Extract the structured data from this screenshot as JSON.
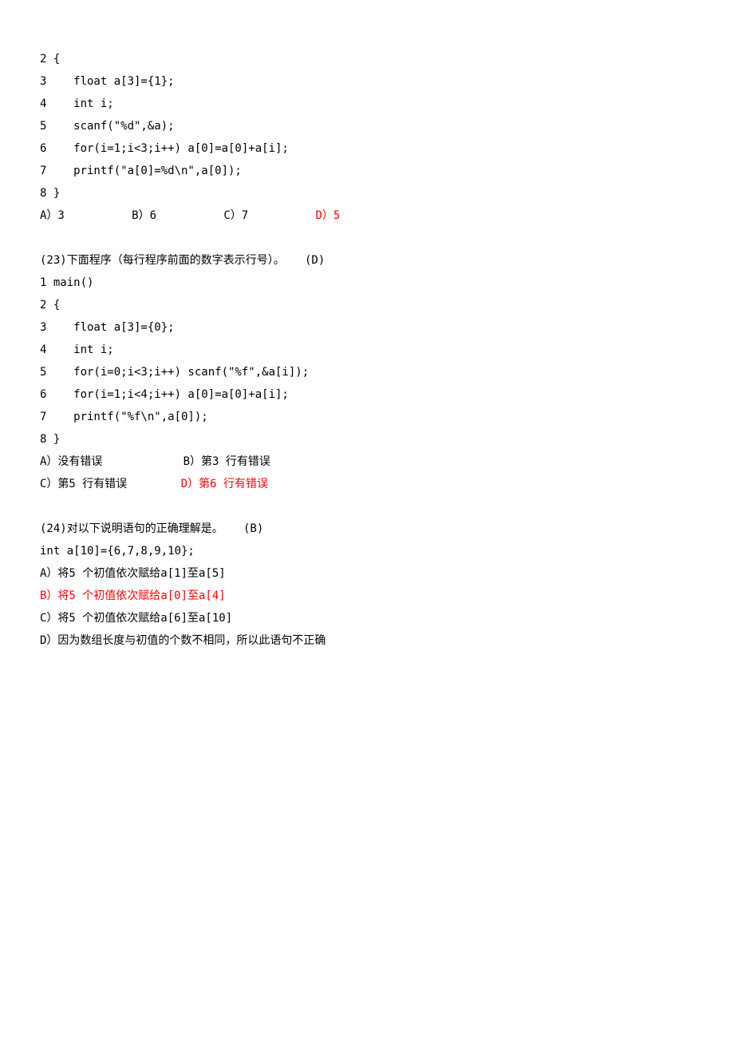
{
  "q22": {
    "code": [
      "2 {",
      "3    float a[3]={1};",
      "4    int i;",
      "5    scanf(\"%d\",&a);",
      "6    for(i=1;i<3;i++) a[0]=a[0]+a[i];",
      "7    printf(\"a[0]=%d\\n\",a[0]);",
      "8 }"
    ],
    "opt_a": "A）3",
    "opt_b": "B）6",
    "opt_c": "C）7",
    "opt_d": "D）5"
  },
  "q23": {
    "title": "(23)下面程序（每行程序前面的数字表示行号）。   (D)",
    "code": [
      "1 main()",
      "2 {",
      "3    float a[3]={0};",
      "4    int i;",
      "5    for(i=0;i<3;i++) scanf(\"%f\",&a[i]);",
      "6    for(i=1;i<4;i++) a[0]=a[0]+a[i];",
      "7    printf(\"%f\\n\",a[0]);",
      "8 }"
    ],
    "opt_a": "A）没有错误",
    "opt_b": "B）第3 行有错误",
    "opt_c": "C）第5 行有错误",
    "opt_d": "D）第6 行有错误"
  },
  "q24": {
    "title": "(24)对以下说明语句的正确理解是。   (B)",
    "decl": "int a[10]={6,7,8,9,10};",
    "opt_a": "A）将5 个初值依次赋给a[1]至a[5]",
    "opt_b": "B）将5 个初值依次赋给a[0]至a[4]",
    "opt_c": "C）将5 个初值依次赋给a[6]至a[10]",
    "opt_d": "D）因为数组长度与初值的个数不相同，所以此语句不正确"
  }
}
